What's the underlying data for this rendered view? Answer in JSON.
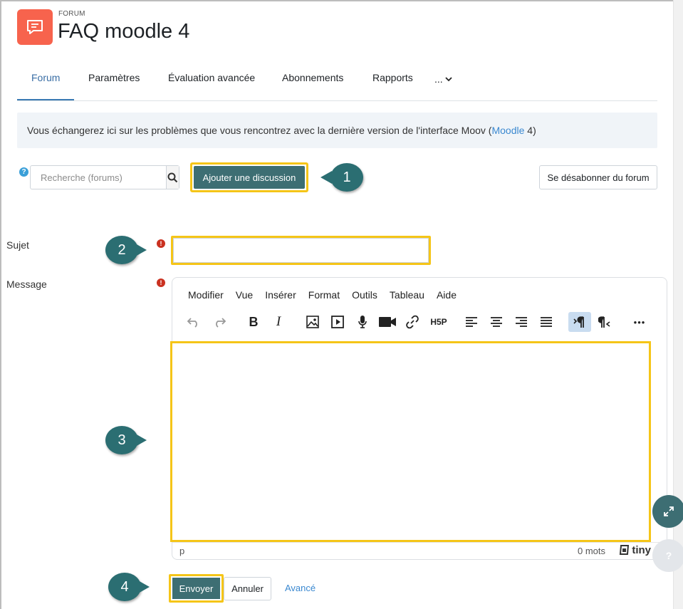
{
  "header": {
    "kicker": "FORUM",
    "title": "FAQ moodle 4",
    "icon": "forum-chat-icon",
    "icon_color": "#f7634d"
  },
  "tabs": [
    {
      "label": "Forum",
      "active": true
    },
    {
      "label": "Paramètres"
    },
    {
      "label": "Évaluation avancée"
    },
    {
      "label": "Abonnements"
    },
    {
      "label": "Rapports"
    },
    {
      "label": "..."
    }
  ],
  "info": {
    "text_before": "Vous échangerez ici sur les problèmes que vous rencontrez avec la dernière version de l'interface Moov (",
    "link": "Moodle",
    "text_after": " 4)"
  },
  "search": {
    "placeholder": "Recherche (forums)",
    "help_glyph": "?"
  },
  "actions": {
    "add_discussion": "Ajouter une discussion",
    "unsubscribe": "Se désabonner du forum"
  },
  "callouts": [
    "1",
    "2",
    "3",
    "4"
  ],
  "form": {
    "subject_label": "Sujet",
    "message_label": "Message",
    "required_glyph": "!"
  },
  "editor": {
    "menu": [
      "Modifier",
      "Vue",
      "Insérer",
      "Format",
      "Outils",
      "Tableau",
      "Aide"
    ],
    "toolbar_icons": [
      "undo-icon",
      "redo-icon",
      "bold-icon",
      "italic-icon",
      "image-icon",
      "media-icon",
      "microphone-icon",
      "video-camera-icon",
      "link-icon",
      "h5p-icon",
      "align-left-icon",
      "align-center-icon",
      "align-right-icon",
      "justify-icon",
      "ltr-icon",
      "rtl-icon",
      "more-icon"
    ],
    "bold_glyph": "B",
    "italic_glyph": "I",
    "h5p_glyph": "H5P",
    "more_glyph": "•••",
    "status_path": "p",
    "word_count": "0 mots",
    "brand": "tiny"
  },
  "submit": {
    "send": "Envoyer",
    "cancel": "Annuler",
    "advanced": "Avancé"
  },
  "floating": {
    "help_glyph": "?"
  },
  "colors": {
    "primary": "#3d6e73",
    "highlight": "#f5c518",
    "callout": "#2b6e72",
    "link": "#3a88d0",
    "required": "#ca3120"
  }
}
